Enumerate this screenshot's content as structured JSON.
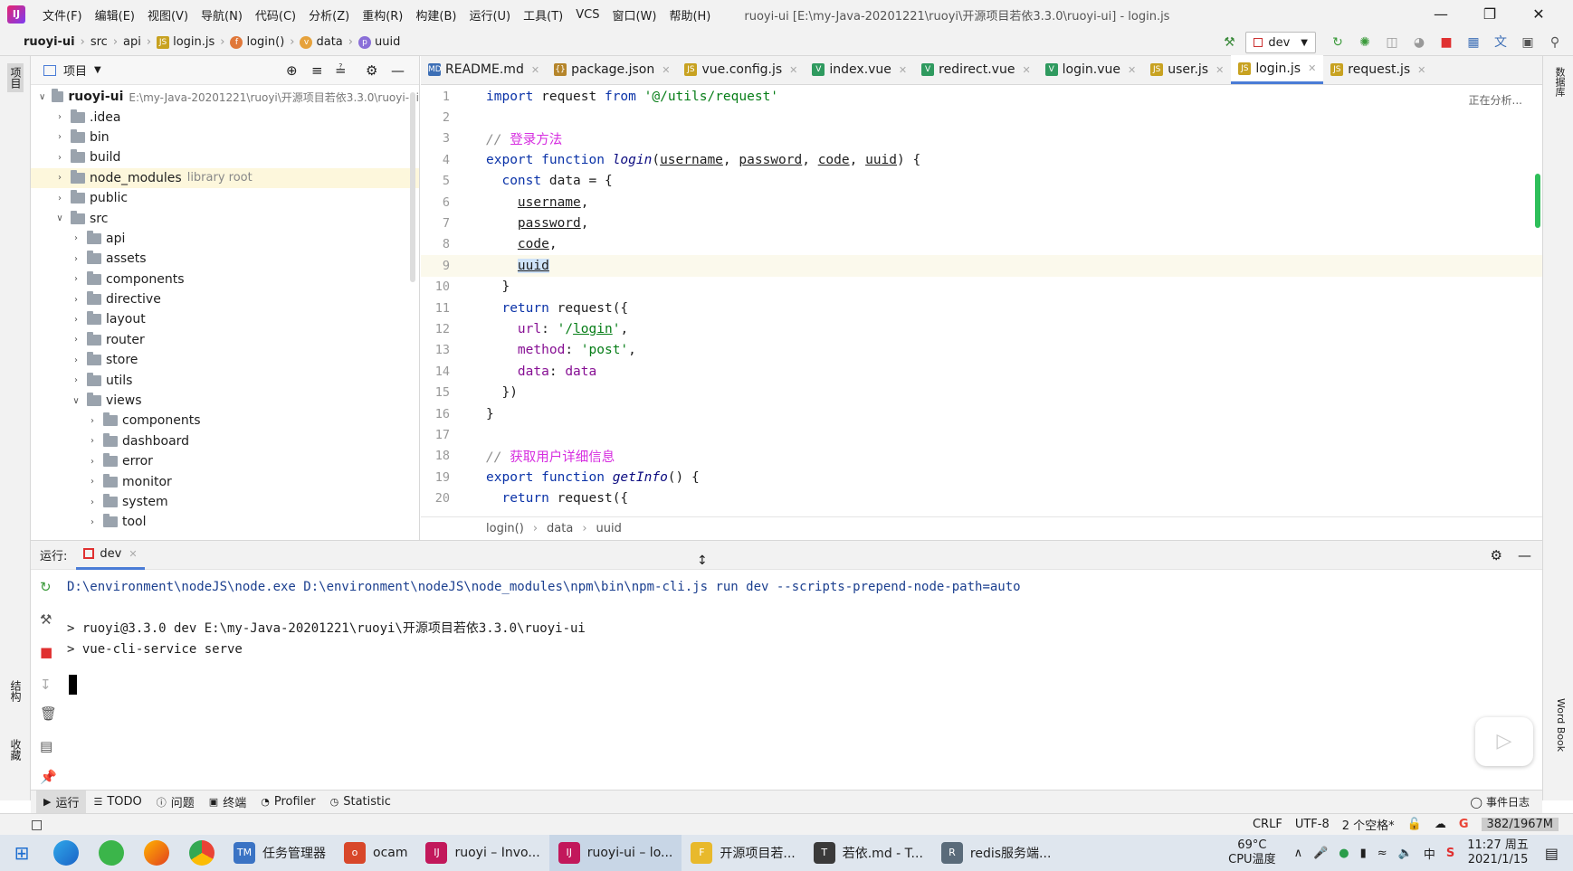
{
  "menubar": {
    "items": [
      "文件(F)",
      "编辑(E)",
      "视图(V)",
      "导航(N)",
      "代码(C)",
      "分析(Z)",
      "重构(R)",
      "构建(B)",
      "运行(U)",
      "工具(T)",
      "VCS",
      "窗口(W)",
      "帮助(H)"
    ],
    "title": "ruoyi-ui [E:\\my-Java-20201221\\ruoyi\\开源项目若依3.3.0\\ruoyi-ui] - login.js"
  },
  "breadcrumb": [
    "ruoyi-ui",
    "src",
    "api",
    "login.js",
    "login()",
    "data",
    "uuid"
  ],
  "toolbar": {
    "run_config": "dev"
  },
  "project": {
    "header": "项目",
    "root_name": "ruoyi-ui",
    "root_path": "E:\\my-Java-20201221\\ruoyi\\开源项目若依3.3.0\\ruoyi-ui",
    "items": [
      {
        "label": ".idea",
        "level": 1,
        "open": false
      },
      {
        "label": "bin",
        "level": 1,
        "open": false
      },
      {
        "label": "build",
        "level": 1,
        "open": false
      },
      {
        "label": "node_modules",
        "level": 1,
        "open": false,
        "suffix": "library root"
      },
      {
        "label": "public",
        "level": 1,
        "open": false
      },
      {
        "label": "src",
        "level": 1,
        "open": true
      },
      {
        "label": "api",
        "level": 2,
        "open": false
      },
      {
        "label": "assets",
        "level": 2,
        "open": false
      },
      {
        "label": "components",
        "level": 2,
        "open": false
      },
      {
        "label": "directive",
        "level": 2,
        "open": false
      },
      {
        "label": "layout",
        "level": 2,
        "open": false
      },
      {
        "label": "router",
        "level": 2,
        "open": false
      },
      {
        "label": "store",
        "level": 2,
        "open": false
      },
      {
        "label": "utils",
        "level": 2,
        "open": false
      },
      {
        "label": "views",
        "level": 2,
        "open": true
      },
      {
        "label": "components",
        "level": 3,
        "open": false
      },
      {
        "label": "dashboard",
        "level": 3,
        "open": false
      },
      {
        "label": "error",
        "level": 3,
        "open": false
      },
      {
        "label": "monitor",
        "level": 3,
        "open": false
      },
      {
        "label": "system",
        "level": 3,
        "open": false
      },
      {
        "label": "tool",
        "level": 3,
        "open": false
      }
    ]
  },
  "tabs": [
    {
      "label": "README.md",
      "icon": "MD",
      "color": "#3d6fb6"
    },
    {
      "label": "package.json",
      "icon": "{}",
      "color": "#b5852b"
    },
    {
      "label": "vue.config.js",
      "icon": "JS",
      "color": "#c8a221"
    },
    {
      "label": "index.vue",
      "icon": "V",
      "color": "#2f9a5f"
    },
    {
      "label": "redirect.vue",
      "icon": "V",
      "color": "#2f9a5f"
    },
    {
      "label": "login.vue",
      "icon": "V",
      "color": "#2f9a5f"
    },
    {
      "label": "user.js",
      "icon": "JS",
      "color": "#c8a221"
    },
    {
      "label": "login.js",
      "icon": "JS",
      "color": "#c8a221",
      "active": true
    },
    {
      "label": "request.js",
      "icon": "JS",
      "color": "#c8a221"
    }
  ],
  "editor": {
    "analyzing": "正在分析...",
    "status_path": [
      "login()",
      "data",
      "uuid"
    ],
    "lines": [
      {
        "n": "1",
        "html": "<span class=\"kw\">import</span> request <span class=\"kw\">from</span> <span class=\"str\">'@/utils/request'</span>"
      },
      {
        "n": "2",
        "html": ""
      },
      {
        "n": "3",
        "html": "<span class=\"cmt\">// </span><span class=\"cmt-cn\">登录方法</span>"
      },
      {
        "n": "4",
        "html": "<span class=\"kw\">export function</span> <span class=\"fn\">login</span>(<span class=\"par\">username</span>, <span class=\"par\">password</span>, <span class=\"par\">code</span>, <span class=\"par\">uuid</span>) {"
      },
      {
        "n": "5",
        "html": "  <span class=\"kw\">const</span> data = {"
      },
      {
        "n": "6",
        "html": "    <span class=\"par\">username</span>,"
      },
      {
        "n": "7",
        "html": "    <span class=\"par\">password</span>,"
      },
      {
        "n": "8",
        "html": "    <span class=\"par\">code</span>,"
      },
      {
        "n": "9",
        "html": "    <span class=\"par\" style=\"background:#cfe3f8\">uuid</span>",
        "current": true
      },
      {
        "n": "10",
        "html": "  }"
      },
      {
        "n": "11",
        "html": "  <span class=\"kw\">return</span> request({"
      },
      {
        "n": "12",
        "html": "    <span class=\"prop\">url</span>: <span class=\"str\">'/<u>login</u>'</span>,"
      },
      {
        "n": "13",
        "html": "    <span class=\"prop\">method</span>: <span class=\"str\">'post'</span>,"
      },
      {
        "n": "14",
        "html": "    <span class=\"prop\">data</span>: <span class=\"prop\">data</span>"
      },
      {
        "n": "15",
        "html": "  })"
      },
      {
        "n": "16",
        "html": "}"
      },
      {
        "n": "17",
        "html": ""
      },
      {
        "n": "18",
        "html": "<span class=\"cmt\">// </span><span class=\"cmt-cn\">获取用户详细信息</span>"
      },
      {
        "n": "19",
        "html": "<span class=\"kw\">export function</span> <span class=\"fn\">getInfo</span>() {"
      },
      {
        "n": "20",
        "html": "  <span class=\"kw\">return</span> request({"
      }
    ]
  },
  "run": {
    "label": "运行:",
    "tab": "dev",
    "console": [
      "D:\\environment\\nodeJS\\node.exe D:\\environment\\nodeJS\\node_modules\\npm\\bin\\npm-cli.js run dev --scripts-prepend-node-path=auto",
      "",
      "> ruoyi@3.3.0 dev E:\\my-Java-20201221\\ruoyi\\开源项目若依3.3.0\\ruoyi-ui",
      "> vue-cli-service serve"
    ]
  },
  "bottom_tools": [
    {
      "label": "运行",
      "icon": "run-icon",
      "active": true
    },
    {
      "label": "TODO",
      "icon": "todo-icon"
    },
    {
      "label": "问题",
      "icon": "problems-icon"
    },
    {
      "label": "终端",
      "icon": "terminal-icon"
    },
    {
      "label": "Profiler",
      "icon": "profiler-icon"
    },
    {
      "label": "Statistic",
      "icon": "statistic-icon"
    }
  ],
  "event_log": "事件日志",
  "statusbar": {
    "line_sep": "CRLF",
    "encoding": "UTF-8",
    "indent": "2 个空格*",
    "memory": "382/1967M"
  },
  "left_strip": {
    "project": "项目",
    "structure": "结构",
    "favorites": "收藏"
  },
  "right_strip": {
    "database": "数据库",
    "wordbook": "Word Book"
  },
  "taskbar": {
    "apps": [
      {
        "label": "任务管理器",
        "color": "#3a73c4",
        "icon": "TM"
      },
      {
        "label": "ocam",
        "color": "#d8472a",
        "icon": "o"
      },
      {
        "label": "ruoyi – Invo...",
        "color": "#c2185b",
        "icon": "IJ"
      },
      {
        "label": "ruoyi-ui – lo...",
        "color": "#c2185b",
        "icon": "IJ",
        "active": true
      },
      {
        "label": "开源项目若...",
        "color": "#e8b92c",
        "icon": "F"
      },
      {
        "label": "若依.md - T...",
        "color": "#3a3a3a",
        "icon": "T"
      },
      {
        "label": "redis服务端...",
        "color": "#5a6b7a",
        "icon": "R"
      }
    ],
    "temp": "69°C",
    "temp_label": "CPU温度",
    "ime": "中",
    "time": "11:27 周五",
    "date": "2021/1/15"
  }
}
